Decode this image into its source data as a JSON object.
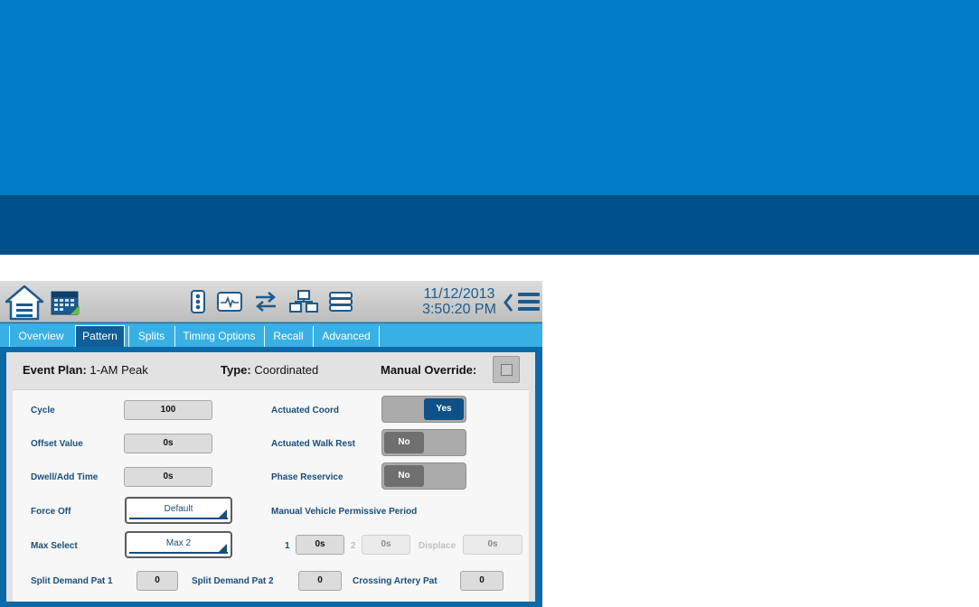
{
  "colors": {
    "banner": "#007dc5",
    "banner_dark": "#005089",
    "accent": "#39b0e3",
    "active_tab": "#0f5e96",
    "label": "#1a4e7b"
  },
  "icons": [
    "home-icon",
    "calendar-icon",
    "traffic-signal-icon",
    "monitor-icon",
    "transfer-icon",
    "network-icon",
    "database-icon",
    "back-chevron-icon",
    "menu-icon"
  ],
  "header": {
    "date": "11/12/2013",
    "time": "3:50:20 PM"
  },
  "tabs": [
    {
      "label": "Overview",
      "active": false
    },
    {
      "label": "Pattern",
      "active": true
    },
    {
      "label": "Splits",
      "active": false
    },
    {
      "label": "Timing Options",
      "active": false
    },
    {
      "label": "Recall",
      "active": false
    },
    {
      "label": "Advanced",
      "active": false
    }
  ],
  "plan": {
    "event_plan_label": "Event Plan:",
    "event_plan_value": "1-AM Peak",
    "type_label": "Type:",
    "type_value": "Coordinated",
    "override_label": "Manual Override:",
    "override_checked": false
  },
  "form": {
    "cycle_label": "Cycle",
    "cycle_value": "100",
    "offset_label": "Offset Value",
    "offset_value": "0s",
    "dwell_label": "Dwell/Add Time",
    "dwell_value": "0s",
    "force_off_label": "Force Off",
    "force_off_value": "Default",
    "max_select_label": "Max Select",
    "max_select_value": "Max 2",
    "actuated_coord_label": "Actuated Coord",
    "actuated_coord_value": "Yes",
    "actuated_walk_label": "Actuated Walk Rest",
    "actuated_walk_value": "No",
    "phase_reservice_label": "Phase Reservice",
    "phase_reservice_value": "No",
    "mvpp_label": "Manual Vehicle Permissive Period",
    "p1_label": "1",
    "p1_value": "0s",
    "p2_label": "2",
    "p2_value": "0s",
    "displace_label": "Displace",
    "displace_value": "0s",
    "split_demand_1_label": "Split Demand Pat 1",
    "split_demand_1_value": "0",
    "split_demand_2_label": "Split Demand Pat 2",
    "split_demand_2_value": "0",
    "crossing_artery_label": "Crossing Artery Pat",
    "crossing_artery_value": "0"
  }
}
